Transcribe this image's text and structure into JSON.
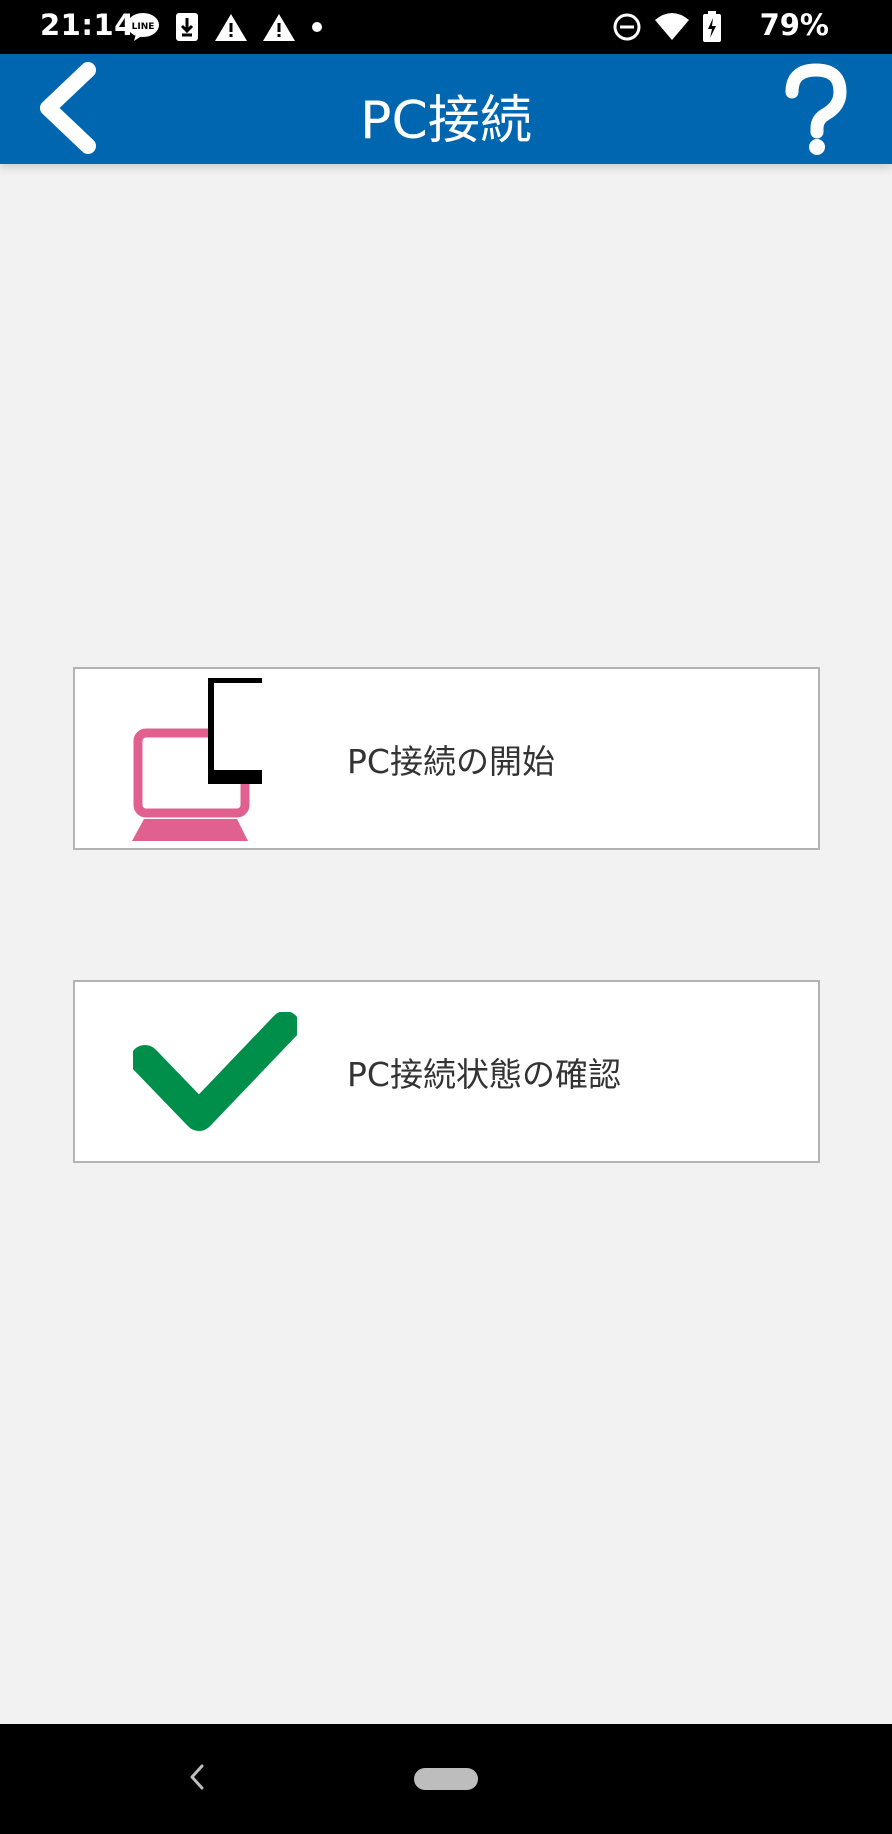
{
  "status_bar": {
    "time": "21:14",
    "battery": "79%",
    "icons_left": [
      "line-icon",
      "download-icon",
      "warning-icon",
      "warning-icon",
      "dot-icon"
    ],
    "icons_right": [
      "dnd-icon",
      "wifi-icon",
      "battery-charging-icon"
    ]
  },
  "header": {
    "title": "PC接続",
    "back_icon": "chevron-left-icon",
    "help_icon": "question-icon"
  },
  "menu": {
    "start": {
      "label": "PC接続の開始",
      "icon": "pc-phone-icon"
    },
    "check": {
      "label": "PC接続状態の確認",
      "icon": "checkmark-icon"
    }
  },
  "colors": {
    "header_bg": "#0066b0",
    "pc_icon": "#e06090",
    "check_icon": "#008f4a"
  },
  "nav_bar": {
    "back_icon": "nav-back-icon",
    "home_icon": "nav-home-pill"
  }
}
